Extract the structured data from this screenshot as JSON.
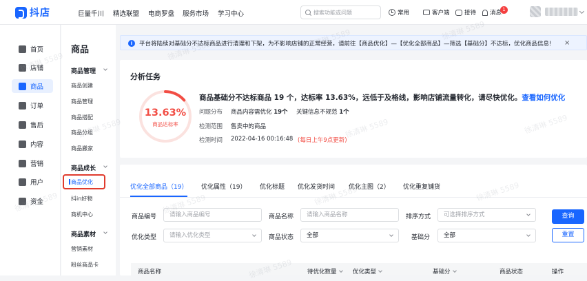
{
  "header": {
    "logo_text": "抖店",
    "nav": [
      "巨量千川",
      "精选联盟",
      "电商罗盘",
      "服务市场",
      "学习中心"
    ],
    "search_placeholder": "搜索功能或问题",
    "tools": {
      "common": "常用",
      "customer_service": "客户端",
      "reception": "接待",
      "messages": "消息"
    },
    "message_badge": "1"
  },
  "sidebar": {
    "items": [
      {
        "label": "首页",
        "icon": "home-icon"
      },
      {
        "label": "店铺",
        "icon": "store-icon"
      },
      {
        "label": "商品",
        "icon": "product-icon",
        "active": true
      },
      {
        "label": "订单",
        "icon": "order-icon"
      },
      {
        "label": "售后",
        "icon": "after-sale-icon"
      },
      {
        "label": "内容",
        "icon": "content-icon"
      },
      {
        "label": "营销",
        "icon": "marketing-icon"
      },
      {
        "label": "用户",
        "icon": "user-icon"
      },
      {
        "label": "资金",
        "icon": "funds-icon"
      }
    ]
  },
  "subnav": {
    "title": "商品",
    "groups": [
      {
        "label": "商品管理",
        "items": [
          "商品创建",
          "商品管理",
          "商品搭配",
          "商品分组",
          "商品搬家"
        ]
      },
      {
        "label": "商品成长",
        "items": [
          "商品优化",
          "抖in好物",
          "商机中心"
        ]
      },
      {
        "label": "商品素材",
        "items": [
          "营销素材",
          "粉丝商品卡"
        ]
      }
    ],
    "active_item": "商品优化"
  },
  "notice": {
    "text": "平台将陆续对基础分不达标商品进行清理和下架，为不影响店铺的正常经营，请前往【商品优化】—【优化全部商品】—筛选【基础分】不达标，优化商品信息!",
    "close": "×"
  },
  "analysis": {
    "title": "分析任务",
    "gauge_value": "13.63%",
    "gauge_label": "商品达标率",
    "gauge_ratio": 0.1363,
    "headline": "商品基础分不达标商品 19 个，达标率 13.63%，远低于及格线，影响店铺流量转化，请尽快优化。",
    "headline_link": "查看如何优化",
    "rows": {
      "problem_label": "问题分布",
      "problem_item1": "商品内容需优化",
      "problem_count1": "19个",
      "problem_item2": "关键信息不规范",
      "problem_count2": "1个",
      "scope_label": "检测范围",
      "scope_value": "售卖中的商品",
      "time_label": "检测时间",
      "time_value": "2022-04-16 00:16:48",
      "time_note": "(每日上午9点更新)"
    }
  },
  "tabs": [
    "优化全部商品（19）",
    "优化属性（19）",
    "优化标题",
    "优化发货时间",
    "优化主图（2）",
    "优化重复铺货"
  ],
  "filters": {
    "product_id_label": "商品编号",
    "product_id_placeholder": "请输入商品编号",
    "product_name_label": "商品名称",
    "product_name_placeholder": "请输入商品名称",
    "sort_label": "排序方式",
    "sort_placeholder": "可选择排序方式",
    "opt_type_label": "优化类型",
    "opt_type_placeholder": "请输入优化类型",
    "status_label": "商品状态",
    "status_value": "全部",
    "score_label": "基础分",
    "score_value": "全部",
    "query_button": "查询",
    "reset_button": "重置"
  },
  "table": {
    "columns": [
      "商品名称",
      "待优化数量",
      "优化类型",
      "基础分",
      "商品状态",
      "操作"
    ]
  },
  "watermark": "徐清琳 5589",
  "colors": {
    "primary": "#1966ff",
    "danger": "#f24d44",
    "highlight_box": "#e03b2d"
  }
}
